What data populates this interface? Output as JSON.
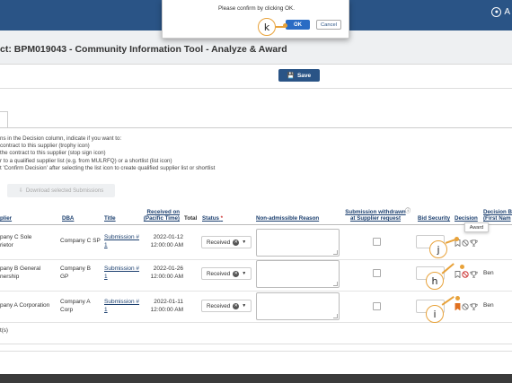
{
  "header": {
    "account_glyph": "A",
    "page_title": "ct: BPM019043 - Community Information Tool - Analyze & Award"
  },
  "toolbar": {
    "save_label": "Save"
  },
  "instructions": [
    "ns in the Decision column, indicate if you want to:",
    "contract to this supplier (trophy icon)",
    "the contract to this supplier (stop sign icon)",
    "r to a qualified supplier list (e.g. from MULRFQ) or a shortlist (list icon)",
    "t 'Confirm Decision' after selecting the list icon to create qualified supplier list or shortlist"
  ],
  "download_label": "Download selected Submissions",
  "table": {
    "headers": {
      "supplier": "plier",
      "dba": "DBA",
      "title": "Title",
      "received_line1": "Received on",
      "received_line2": "(Pacific Time)",
      "total": "Total",
      "status": "Status",
      "status_req": "*",
      "non_admissible": "Non-admissible Reason",
      "withdrawn_line1": "Submission withdrawn",
      "withdrawn_line2": "at Supplier request",
      "bid_security": "Bid Security",
      "decision": "Decision",
      "decision_by_line1": "Decision B",
      "decision_by_line2": "(First Nam"
    },
    "rows": [
      {
        "supplier_line1": "pany C Sole",
        "supplier_line2": "rietor",
        "dba_line1": "Company C SP",
        "dba_line2": "",
        "title_line1": "Submission #",
        "title_line2": "1",
        "date": "2022-01-12",
        "time": "12:00:00 AM",
        "status": "Received",
        "decision_by": ""
      },
      {
        "supplier_line1": "pany B General",
        "supplier_line2": "nership",
        "dba_line1": "Company B",
        "dba_line2": "GP",
        "title_line1": "Submission #",
        "title_line2": "1",
        "date": "2022-01-26",
        "time": "12:00:00 AM",
        "status": "Received",
        "decision_by": "Ben"
      },
      {
        "supplier_line1": "pany A Corporation",
        "supplier_line2": "",
        "dba_line1": "Company A",
        "dba_line2": "Corp",
        "title_line1": "Submission #",
        "title_line2": "1",
        "date": "2022-01-11",
        "time": "12:00:00 AM",
        "status": "Received",
        "decision_by": "Ben"
      }
    ],
    "footer_count": "t(s)"
  },
  "tooltip": "Award",
  "dialog": {
    "message": "Please confirm by clicking OK.",
    "ok_label": "OK",
    "cancel_label": "Cancel"
  },
  "markers": {
    "k": "k",
    "j": "j",
    "h": "h",
    "i": "i"
  },
  "colors": {
    "brand": "#2a5486",
    "accent": "#e8a23a",
    "ok_button": "#2a6cc4",
    "flag_active": "#e07020",
    "stop_active": "#cc3333"
  }
}
